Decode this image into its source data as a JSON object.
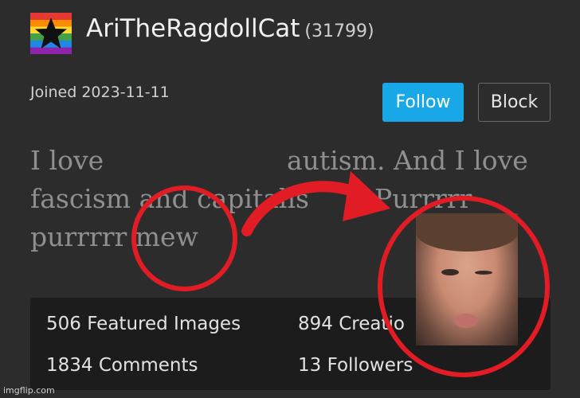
{
  "profile": {
    "username": "AriTheRagdollCat",
    "score": "(31799)",
    "joined": "Joined 2023-11-11",
    "avatar_icon": "black-star-on-rainbow-flag"
  },
  "actions": {
    "follow_label": "Follow",
    "block_label": "Block",
    "follow_color": "#18a8e8"
  },
  "bio": {
    "line1_a": "I love",
    "line1_b": "autism. And I love",
    "line2_a": "fascism and capitalis",
    "line2_b": "Purrrrr",
    "line3": "purrrrr mew"
  },
  "stats": {
    "featured_images": "506 Featured Images",
    "creations": "894 Creatio",
    "comments": "1834 Comments",
    "followers": "13 Followers"
  },
  "overlay": {
    "circle_color": "#e21c25"
  },
  "watermark": "imgflip.com"
}
